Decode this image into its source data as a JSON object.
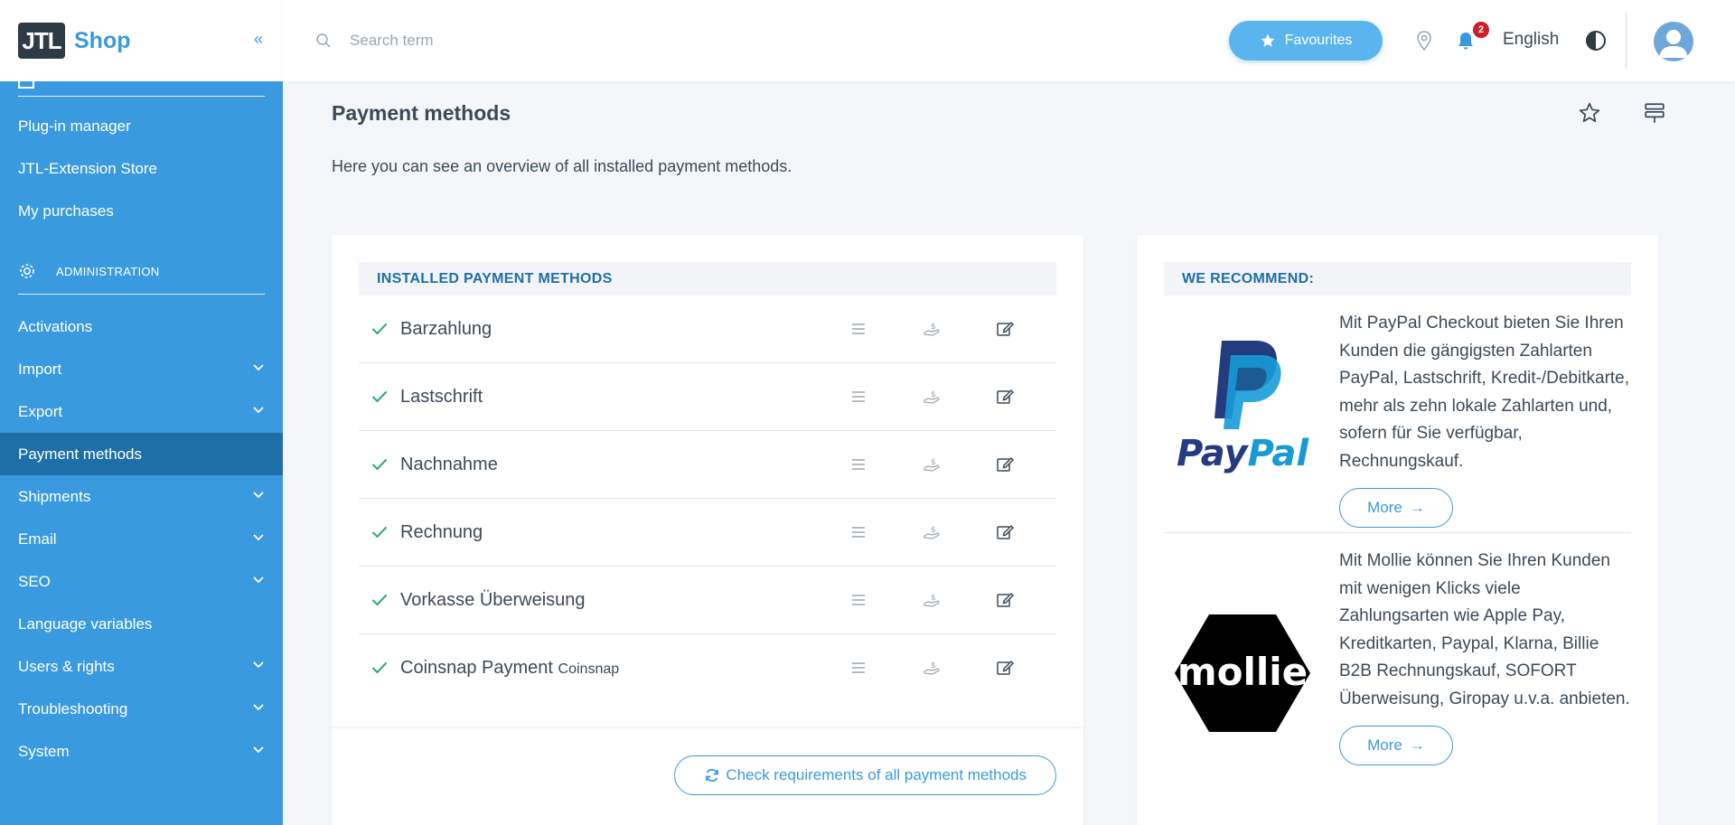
{
  "brand": {
    "logo_mark": "JTL",
    "name": "Shop",
    "collapse_icon": "«"
  },
  "colors": {
    "sidebar": "#3a9ae0",
    "sidebar_active": "#1e6fa8",
    "accent": "#3a9ae0",
    "success": "#2aa77a",
    "badge": "#d01b2a"
  },
  "sidebar": {
    "items_top": [
      {
        "label": "Plug-in manager"
      },
      {
        "label": "JTL-Extension Store"
      },
      {
        "label": "My purchases"
      }
    ],
    "section": {
      "label": "ADMINISTRATION",
      "icon": "gear-icon"
    },
    "items": [
      {
        "label": "Activations",
        "expandable": false
      },
      {
        "label": "Import",
        "expandable": true
      },
      {
        "label": "Export",
        "expandable": true
      },
      {
        "label": "Payment methods",
        "expandable": false,
        "active": true
      },
      {
        "label": "Shipments",
        "expandable": true
      },
      {
        "label": "Email",
        "expandable": true
      },
      {
        "label": "SEO",
        "expandable": true
      },
      {
        "label": "Language variables",
        "expandable": false
      },
      {
        "label": "Users & rights",
        "expandable": true
      },
      {
        "label": "Troubleshooting",
        "expandable": true
      },
      {
        "label": "System",
        "expandable": true
      }
    ]
  },
  "topbar": {
    "search_placeholder": "Search term",
    "favourites_label": "Favourites",
    "notification_count": "2",
    "language": "English"
  },
  "main": {
    "title": "Payment methods",
    "description": "Here you can see an overview of all installed payment methods.",
    "installed": {
      "heading": "INSTALLED PAYMENT METHODS",
      "methods": [
        {
          "name": "Barzahlung",
          "suffix": ""
        },
        {
          "name": "Lastschrift",
          "suffix": ""
        },
        {
          "name": "Nachnahme",
          "suffix": ""
        },
        {
          "name": "Rechnung",
          "suffix": ""
        },
        {
          "name": "Vorkasse Überweisung",
          "suffix": ""
        },
        {
          "name": "Coinsnap Payment",
          "suffix": "Coinsnap"
        }
      ],
      "check_button": "Check requirements of all payment methods"
    },
    "recommend": {
      "heading": "WE RECOMMEND:",
      "items": [
        {
          "logo": "PayPal",
          "text": "Mit PayPal Checkout bieten Sie Ihren Kunden die gängigsten Zahlarten PayPal, Lastschrift, Kredit-/Debitkarte, mehr als zehn lokale Zahlarten und, sofern für Sie verfügbar, Rechnungskauf.",
          "more_label": "More"
        },
        {
          "logo": "mollie",
          "text": "Mit Mollie können Sie Ihren Kunden mit wenigen Klicks viele Zahlungsarten wie Apple Pay, Kreditkarten, Paypal, Klarna, Billie B2B Rechnungskauf, SOFORT Überweisung, Giropay u.v.a. anbieten.",
          "more_label": "More"
        }
      ]
    }
  }
}
